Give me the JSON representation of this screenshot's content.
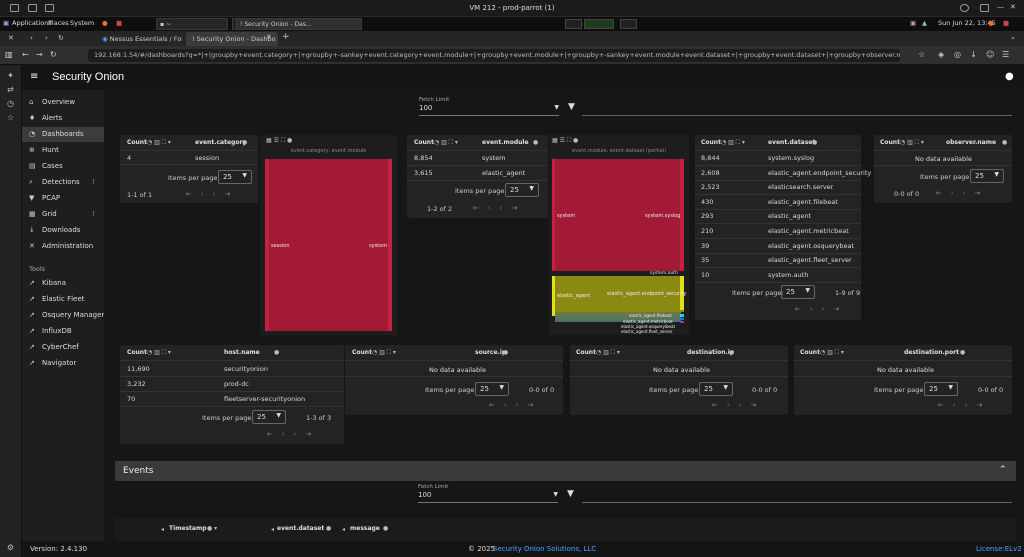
{
  "vm": {
    "title": "VM 212 - prod-parrot (1)"
  },
  "panel": {
    "applications": "Applications",
    "places": "Places",
    "system": "System",
    "task1": "~",
    "task2": "~",
    "task3": "! Security Onion - Das...",
    "clock": "Sun Jun 22, 13:45"
  },
  "browser": {
    "tabs": [
      {
        "label": "Nessus Essentials / Folde"
      },
      {
        "label": "! Security Onion - Dashbo"
      }
    ],
    "url": "192.168.1.54/#/dashboards?q=*|+|groupby+event.category+|+groupby+-sankey+event.category+event.module+|+groupby+event.module+|+groupby+-sankey+event.module+event.dataset+|+groupby+event.dataset+|+groupby+observer.name+|+groupby+host.name+|+gr..."
  },
  "app": {
    "logo_text": "Security Onion",
    "nav": [
      {
        "label": "Overview",
        "icon": "home-icon"
      },
      {
        "label": "Alerts",
        "icon": "bell-icon"
      },
      {
        "label": "Dashboards",
        "icon": "dashboard-icon"
      },
      {
        "label": "Hunt",
        "icon": "crosshair-icon"
      },
      {
        "label": "Cases",
        "icon": "briefcase-icon"
      },
      {
        "label": "Detections",
        "icon": "search-icon",
        "warn": "!"
      },
      {
        "label": "PCAP",
        "icon": "download-icon"
      },
      {
        "label": "Grid",
        "icon": "grid-icon",
        "warn": "!"
      },
      {
        "label": "Downloads",
        "icon": "download-icon"
      },
      {
        "label": "Administration",
        "icon": "wrench-icon"
      }
    ],
    "tools_heading": "Tools",
    "tools": [
      {
        "label": "Kibana"
      },
      {
        "label": "Elastic Fleet"
      },
      {
        "label": "Osquery Manager"
      },
      {
        "label": "InfluxDB"
      },
      {
        "label": "CyberChef"
      },
      {
        "label": "Navigator"
      }
    ]
  },
  "fetch": {
    "label": "Fetch Limit",
    "value": "100"
  },
  "common": {
    "count": "Count",
    "ipp": "Items per page:",
    "ipp_value": "25",
    "nodata": "No data available"
  },
  "tables": {
    "category": {
      "header": "event.category",
      "rows": [
        {
          "count": "4",
          "value": "session"
        }
      ],
      "range": "1-1 of 1"
    },
    "sankey1": {
      "title": "event.category, event.module",
      "left": "session",
      "right": "system"
    },
    "module": {
      "header": "event.module",
      "rows": [
        {
          "count": "8,854",
          "value": "system"
        },
        {
          "count": "3,615",
          "value": "elastic_agent"
        }
      ],
      "range": "1-2 of 2"
    },
    "sankey2": {
      "title": "event.module, event.dataset (partial)",
      "left_a": "system",
      "left_b": "elastic_agent",
      "right_a": "system.syslog",
      "right_b": "system.auth",
      "right_c": "elastic_agent.endpoint_security",
      "right_d": "elastic_agent.filebeat",
      "right_e": "elastic_agent.metricbeat",
      "right_f": "elastic_agent.osqueryibeat",
      "right_g": "elastic_agent.fleet_server"
    },
    "dataset": {
      "header": "event.dataset",
      "rows": [
        {
          "count": "8,844",
          "value": "system.syslog"
        },
        {
          "count": "2,608",
          "value": "elastic_agent.endpoint_security"
        },
        {
          "count": "2,523",
          "value": "elasticsearch.server"
        },
        {
          "count": "430",
          "value": "elastic_agent.filebeat"
        },
        {
          "count": "293",
          "value": "elastic_agent"
        },
        {
          "count": "210",
          "value": "elastic_agent.metricbeat"
        },
        {
          "count": "39",
          "value": "elastic_agent.osquerybeat"
        },
        {
          "count": "35",
          "value": "elastic_agent.fleet_server"
        },
        {
          "count": "10",
          "value": "system.auth"
        }
      ],
      "range": "1-9 of 9"
    },
    "observer": {
      "header": "observer.name",
      "range": "0-0 of 0"
    },
    "host": {
      "header": "host.name",
      "rows": [
        {
          "count": "11,690",
          "value": "securityonion"
        },
        {
          "count": "3,232",
          "value": "prod-dc"
        },
        {
          "count": "70",
          "value": "fleetserver-securityonion"
        }
      ],
      "range": "1-3 of 3"
    },
    "sourceip": {
      "header": "source.ip",
      "range": "0-0 of 0"
    },
    "destip": {
      "header": "destination.ip",
      "range": "0-0 of 0"
    },
    "destport": {
      "header": "destination.port",
      "range": "0-0 of 0"
    }
  },
  "events": {
    "title": "Events",
    "cols": {
      "timestamp": "Timestamp",
      "dataset": "event.dataset",
      "message": "message"
    }
  },
  "footer": {
    "version": "Version: 2.4.130",
    "copyright": "© 2025",
    "company": "Security Onion Solutions, LLC",
    "license": "License:ELv2"
  },
  "colors": {
    "sankey_red": "#a21a36",
    "sankey_yellow": "#8a8a13",
    "accent_blue": "#4aa3ff",
    "warn_orange": "#e06b20"
  }
}
